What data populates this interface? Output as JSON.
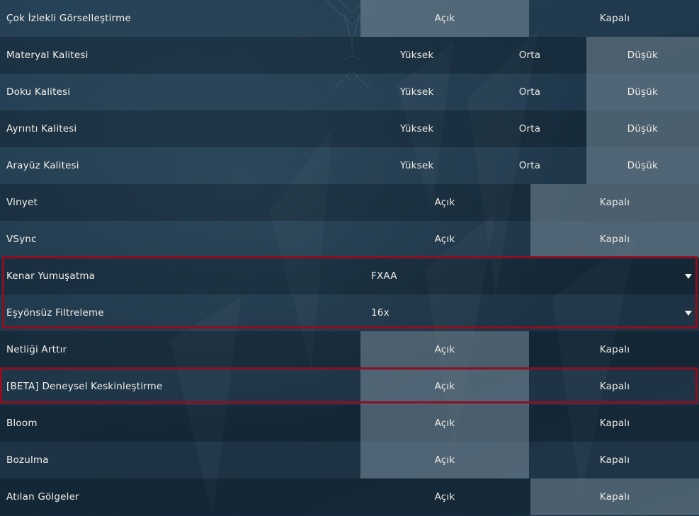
{
  "rows": [
    {
      "label": "Çok İzlekli Görselleştirme",
      "options": [
        "Açık",
        "Kapalı"
      ]
    },
    {
      "label": "Materyal Kalitesi",
      "options": [
        "Yüksek",
        "Orta",
        "Düşük"
      ]
    },
    {
      "label": "Doku Kalitesi",
      "options": [
        "Yüksek",
        "Orta",
        "Düşük"
      ]
    },
    {
      "label": "Ayrıntı Kalitesi",
      "options": [
        "Yüksek",
        "Orta",
        "Düşük"
      ]
    },
    {
      "label": "Arayüz Kalitesi",
      "options": [
        "Yüksek",
        "Orta",
        "Düşük"
      ]
    },
    {
      "label": "Vinyet",
      "options": [
        "Açık",
        "Kapalı"
      ]
    },
    {
      "label": "VSync",
      "options": [
        "Açık",
        "Kapalı"
      ]
    },
    {
      "label": "Kenar Yumuşatma",
      "value": "FXAA"
    },
    {
      "label": "Eşyönsüz Filtreleme",
      "value": "16x"
    },
    {
      "label": "Netliği Arttır",
      "options": [
        "Açık",
        "Kapalı"
      ]
    },
    {
      "label": "[BETA] Deneysel Keskinleştirme",
      "options": [
        "Açık",
        "Kapalı"
      ]
    },
    {
      "label": "Bloom",
      "options": [
        "Açık",
        "Kapalı"
      ]
    },
    {
      "label": "Bozulma",
      "options": [
        "Açık",
        "Kapalı"
      ]
    },
    {
      "label": "Atılan Gölgeler",
      "options": [
        "Açık",
        "Kapalı"
      ]
    }
  ],
  "selected": {
    "multithreaded_rendering": "Açık",
    "material_quality": "Düşük",
    "texture_quality": "Düşük",
    "detail_quality": "Düşük",
    "ui_quality": "Düşük",
    "vignette": "Kapalı",
    "vsync": "Kapalı",
    "improve_clarity": "Açık",
    "experimental_sharpening": "Açık",
    "bloom": "Açık",
    "distortion": "Açık",
    "cast_shadows": "Kapalı"
  },
  "colors": {
    "highlight_border": "#8c0f22",
    "selected_option": "#6f8290"
  },
  "icons": {
    "dropdown": "caret-down-icon"
  }
}
